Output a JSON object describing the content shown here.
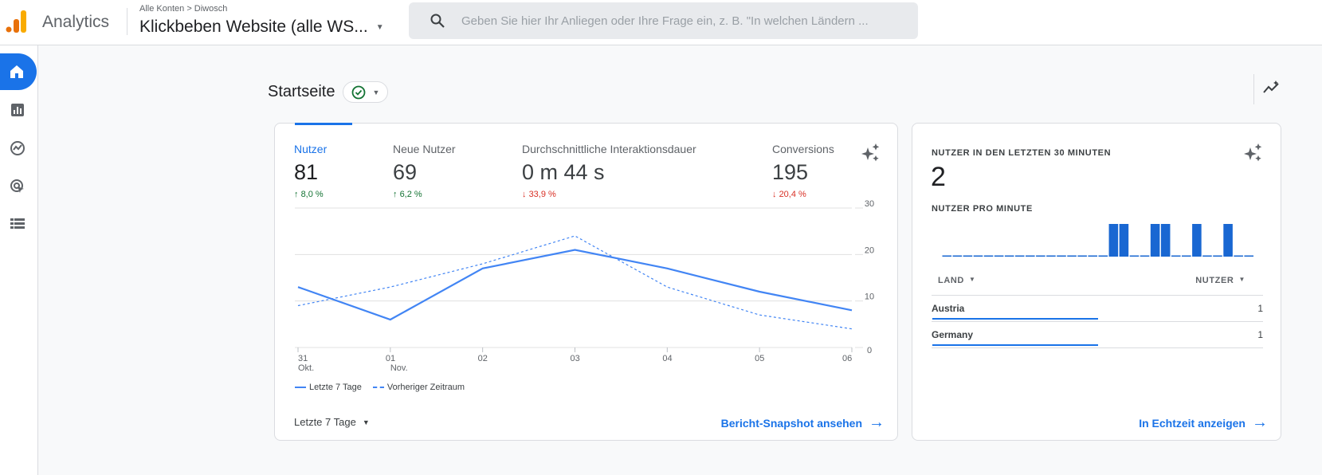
{
  "header": {
    "app_name": "Analytics",
    "breadcrumb": "Alle Konten > Diwosch",
    "property": "Klickbeben Website (alle WS...",
    "search_placeholder": "Geben Sie hier Ihr Anliegen oder Ihre Frage ein, z. B. \"In welchen Ländern ..."
  },
  "sidebar": {
    "items": [
      {
        "icon": "home-icon",
        "active": true
      },
      {
        "icon": "reports-icon"
      },
      {
        "icon": "explore-icon"
      },
      {
        "icon": "advertising-icon"
      },
      {
        "icon": "configure-icon"
      }
    ]
  },
  "page": {
    "title": "Startseite"
  },
  "overview": {
    "metrics": [
      {
        "label": "Nutzer",
        "value": "81",
        "change": "8,0 %",
        "direction": "up",
        "active": true
      },
      {
        "label": "Neue Nutzer",
        "value": "69",
        "change": "6,2 %",
        "direction": "up"
      },
      {
        "label": "Durchschnittliche Interaktionsdauer",
        "value": "0 m 44 s",
        "change": "33,9 %",
        "direction": "down"
      },
      {
        "label": "Conversions",
        "value": "195",
        "change": "20,4 %",
        "direction": "down"
      }
    ],
    "range_label": "Letzte 7 Tage",
    "link": "Bericht-Snapshot ansehen"
  },
  "chart_data": [
    {
      "type": "line",
      "x": [
        "31 Okt.",
        "01 Nov.",
        "02",
        "03",
        "04",
        "05",
        "06"
      ],
      "x_ticks": [
        [
          "31",
          "Okt."
        ],
        [
          "01",
          "Nov."
        ],
        [
          "02",
          ""
        ],
        [
          "03",
          ""
        ],
        [
          "04",
          ""
        ],
        [
          "05",
          ""
        ],
        [
          "06",
          ""
        ]
      ],
      "y_ticks": [
        "30",
        "20",
        "10",
        "0"
      ],
      "ylim": [
        0,
        30
      ],
      "grid": true,
      "legend": "bottom-left",
      "series": [
        {
          "name": "Letzte 7 Tage",
          "style": "solid",
          "values": [
            13,
            6,
            17,
            21,
            17,
            12,
            8
          ]
        },
        {
          "name": "Vorheriger Zeitraum",
          "style": "dashed",
          "values": [
            9,
            13,
            18,
            24,
            13,
            7,
            4
          ]
        }
      ],
      "color": "#4285f4"
    },
    {
      "type": "bar",
      "title": "NUTZER PRO MINUTE",
      "values": [
        0,
        0,
        0,
        0,
        0,
        0,
        0,
        0,
        0,
        0,
        0,
        0,
        0,
        0,
        0,
        0,
        1,
        1,
        0,
        0,
        1,
        1,
        0,
        0,
        1,
        0,
        0,
        1,
        0,
        0
      ],
      "color": "#1967d2"
    }
  ],
  "realtime": {
    "title": "NUTZER IN DEN LETZTEN 30 MINUTEN",
    "value": "2",
    "bars_title": "NUTZER PRO MINUTE",
    "col_country": "LAND",
    "col_users": "NUTZER",
    "rows": [
      {
        "country": "Austria",
        "users": "1",
        "share": 0.5
      },
      {
        "country": "Germany",
        "users": "1",
        "share": 0.5
      }
    ],
    "link": "In Echtzeit anzeigen"
  }
}
